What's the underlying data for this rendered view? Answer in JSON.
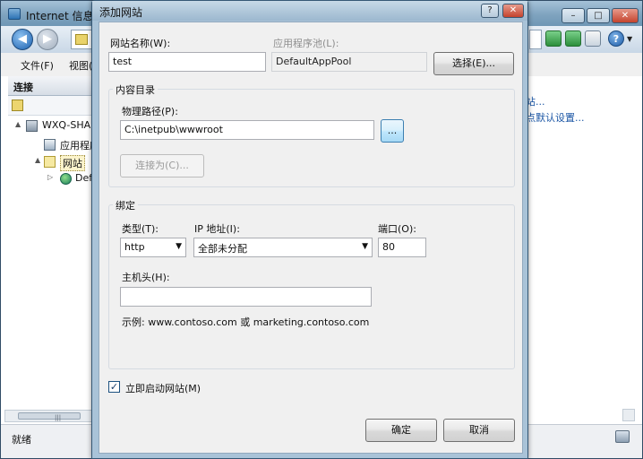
{
  "iis": {
    "title": "Internet 信息服",
    "menu": [
      "文件(F)",
      "视图(I"
    ],
    "connections_header": "连接",
    "tree": {
      "server": "WXQ-SHA",
      "app_pools": "应用程序",
      "sites": "网站",
      "default_site": "Def"
    },
    "actions": [
      "站...",
      "点默认设置..."
    ],
    "status": "就绪",
    "window_controls": {
      "minimize": "–",
      "maximize": "□",
      "close": "✕"
    },
    "toggle_expanded": "▲",
    "toggle_collapsed": "▷",
    "scroll_grip": "|||"
  },
  "dialog": {
    "title": "添加网站",
    "help_button": "?",
    "close_button": "✕",
    "site_name_label": "网站名称(W):",
    "site_name_value": "test",
    "app_pool_label": "应用程序池(L):",
    "app_pool_value": "DefaultAppPool",
    "select_button": "选择(E)...",
    "content_dir": {
      "group_title": "内容目录",
      "physical_path_label": "物理路径(P):",
      "physical_path_value": "C:\\inetpub\\wwwroot",
      "browse_button": "...",
      "connect_as_button": "连接为(C)..."
    },
    "binding": {
      "group_title": "绑定",
      "type_label": "类型(T):",
      "type_value": "http",
      "ip_label": "IP 地址(I):",
      "ip_value": "全部未分配",
      "port_label": "端口(O):",
      "port_value": "80",
      "host_label": "主机头(H):",
      "host_value": "",
      "example": "示例: www.contoso.com 或 marketing.contoso.com"
    },
    "start_now_label": "立即启动网站(M)",
    "start_now_checked": true,
    "check_mark": "✓",
    "dropdown_arrow": "▼",
    "ok_button": "确定",
    "cancel_button": "取消"
  },
  "icons": {
    "nav_back": "arrow-left-icon",
    "nav_forward": "arrow-right-icon",
    "back_glyph": "◀",
    "forward_glyph": "▶",
    "help_glyph": "?",
    "help_menu_glyph": "▼"
  },
  "colors": {
    "titlebar": "#7fa3bf",
    "dialog_frame": "#a9c3d8",
    "link": "#1b56a5",
    "close": "#c4432d"
  }
}
